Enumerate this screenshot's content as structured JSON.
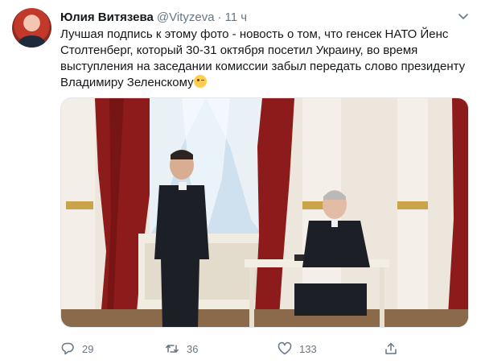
{
  "tweet": {
    "author_name": "Юлия Витязева",
    "author_handle": "@Vityzeva",
    "separator": "·",
    "time": "11 ч",
    "text_lines": [
      "Лучшая подпись к этому фото - новость о том, что генсек НАТО Йенс",
      "Столтенберг, который 30-31 октября посетил Украину, во время",
      "выступления на заседании комиссии забыл передать слово президенту",
      "Владимиру Зеленскому"
    ],
    "emoji": "winking-face"
  },
  "actions": {
    "replies": "29",
    "retweets": "36",
    "likes": "133"
  },
  "icons": {
    "avatar": "user-avatar",
    "menu": "chevron-down-icon",
    "reply": "reply-icon",
    "retweet": "retweet-icon",
    "like": "heart-icon",
    "share": "share-icon"
  },
  "colors": {
    "text": "#14171a",
    "secondary": "#657786",
    "border": "#e1e8ed"
  }
}
